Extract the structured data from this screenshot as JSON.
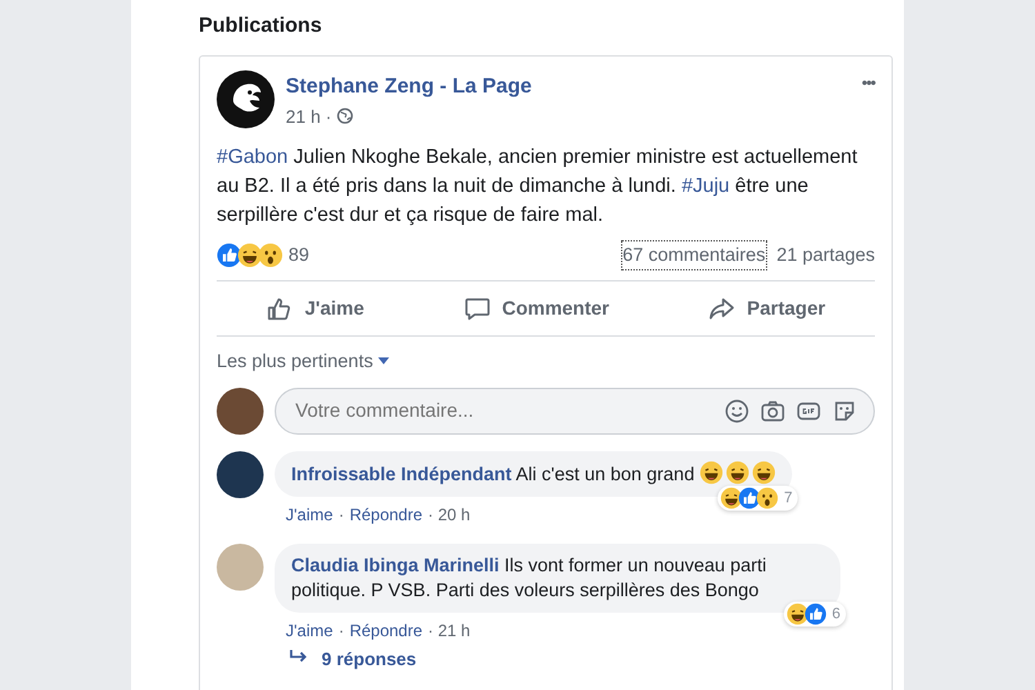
{
  "section_title": "Publications",
  "post": {
    "author": "Stephane Zeng - La Page",
    "time": "21 h ·",
    "more": "•••",
    "text": [
      {
        "kind": "hashtag",
        "text": "#Gabon"
      },
      {
        "kind": "plain",
        "text": " Julien Nkoghe Bekale, ancien premier ministre est actuellement au B2. Il a été pris dans la nuit de dimanche à lundi. "
      },
      {
        "kind": "hashtag",
        "text": "#Juju"
      },
      {
        "kind": "plain",
        "text": " être une serpillère c'est dur et ça risque de faire mal."
      }
    ],
    "reactions": [
      {
        "kind": "like"
      },
      {
        "kind": "haha"
      },
      {
        "kind": "wow"
      }
    ],
    "reaction_count": "89",
    "comments_count": "67 commentaires",
    "shares_count": "21 partages",
    "actions": [
      {
        "kind": "like",
        "label": "J'aime"
      },
      {
        "kind": "comment",
        "label": "Commenter"
      },
      {
        "kind": "share",
        "label": "Partager"
      }
    ]
  },
  "comments_sort": "Les plus pertinents",
  "comment_box": {
    "placeholder": "Votre commentaire..."
  },
  "comments": [
    {
      "author": "Infroissable Indépendant",
      "text": "Ali c'est un bon grand",
      "emojis": [
        {
          "kind": "haha"
        },
        {
          "kind": "haha"
        },
        {
          "kind": "haha"
        }
      ],
      "reactions": [
        {
          "kind": "haha"
        },
        {
          "kind": "like"
        },
        {
          "kind": "wow"
        }
      ],
      "reaction_count": "7",
      "like": "J'aime",
      "separator": "·",
      "reply": "Répondre",
      "time": "· 20 h"
    },
    {
      "author": "Claudia Ibinga Marinelli",
      "text": "Ils vont former un nouveau parti politique. P VSB. Parti des voleurs serpillères des Bongo",
      "reactions": [
        {
          "kind": "haha"
        },
        {
          "kind": "like"
        }
      ],
      "reaction_count": "6",
      "like": "J'aime",
      "separator": "·",
      "reply": "Répondre",
      "time": "· 21 h"
    }
  ],
  "replies_link": "9 réponses"
}
